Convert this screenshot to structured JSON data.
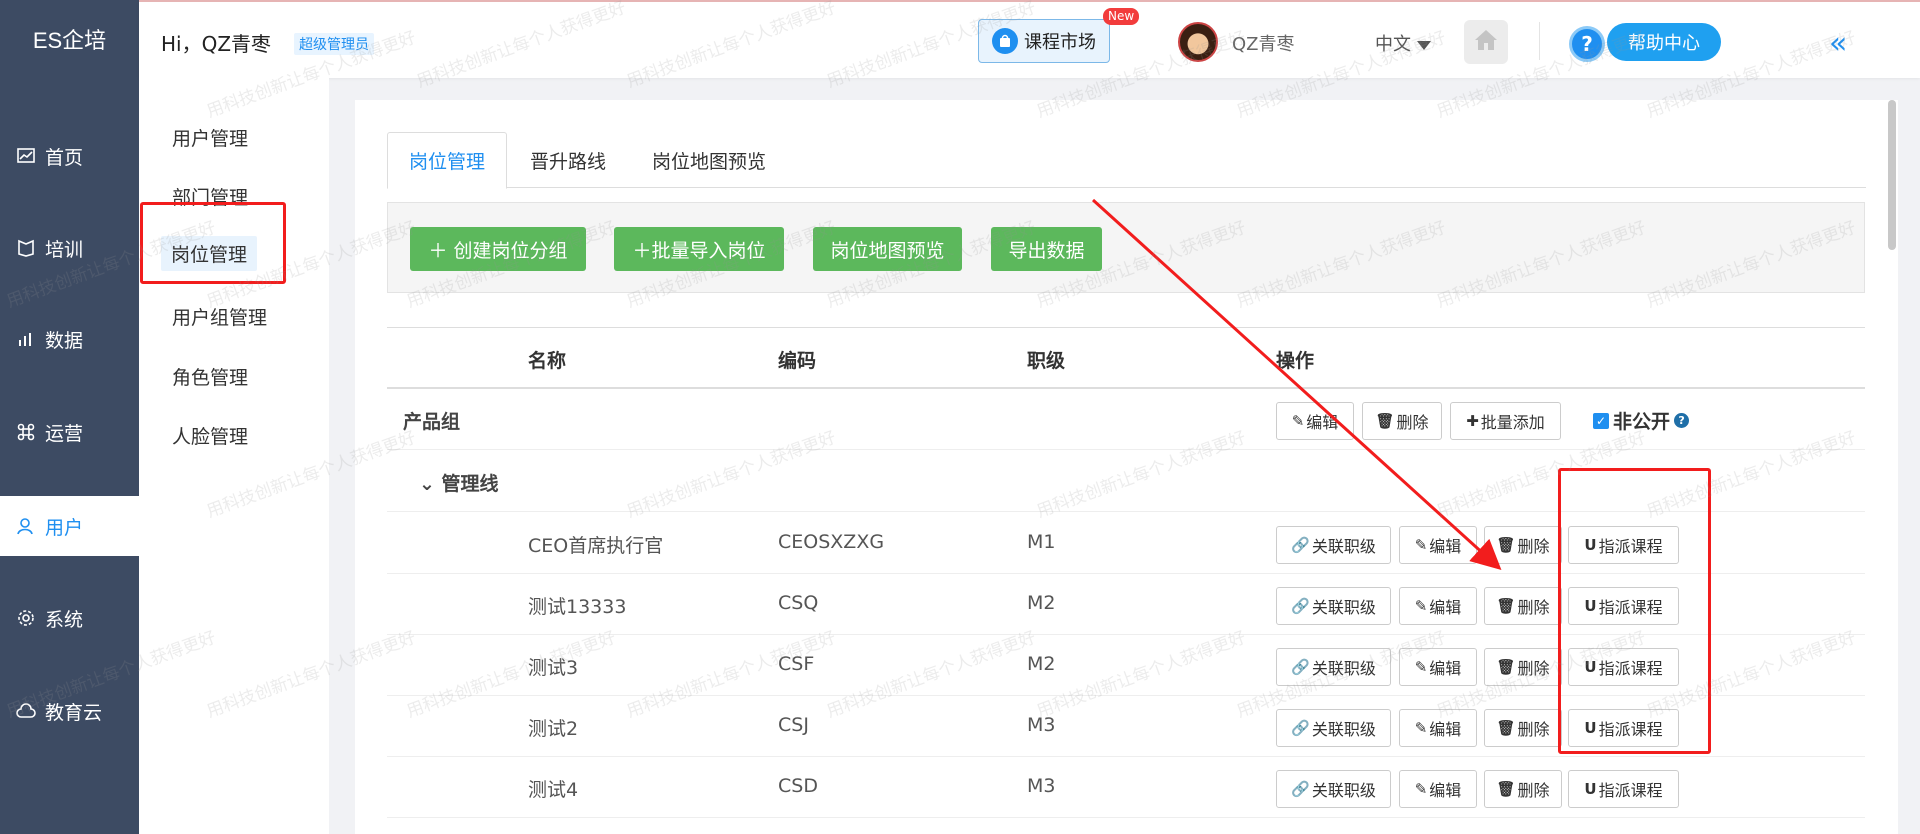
{
  "brand": "ES企培",
  "nav": [
    {
      "label": "首页",
      "icon": "chart-line-icon"
    },
    {
      "label": "培训",
      "icon": "training-icon"
    },
    {
      "label": "数据",
      "icon": "bar-chart-icon"
    },
    {
      "label": "运营",
      "icon": "command-icon"
    },
    {
      "label": "用户",
      "icon": "user-icon"
    },
    {
      "label": "系统",
      "icon": "gear-icon"
    },
    {
      "label": "教育云",
      "icon": "cloud-icon"
    }
  ],
  "header": {
    "greeting": "Hi，QZ青枣",
    "role": "超级管理员",
    "market": "课程市场",
    "new_badge": "New",
    "username": "QZ青枣",
    "language": "中文",
    "help": "帮助中心"
  },
  "submenu": [
    "用户管理",
    "部门管理",
    "岗位管理",
    "用户组管理",
    "角色管理",
    "人脸管理"
  ],
  "tabs": [
    "岗位管理",
    "晋升路线",
    "岗位地图预览"
  ],
  "toolbar": {
    "create_group": "＋ 创建岗位分组",
    "batch_import": "＋批量导入岗位",
    "map_preview": "岗位地图预览",
    "export": "导出数据"
  },
  "table": {
    "headers": {
      "name": "名称",
      "code": "编码",
      "level": "职级",
      "ops": "操作"
    },
    "group": {
      "name": "产品组",
      "edit": "编辑",
      "delete": "删除",
      "batch_add": "批量添加",
      "private": "非公开"
    },
    "subgroup": "管理线",
    "row_actions": {
      "link_level": "关联职级",
      "edit": "编辑",
      "delete": "删除",
      "assign": "指派课程"
    },
    "rows": [
      {
        "name": "CEO首席执行官",
        "code": "CEOSXZXG",
        "level": "M1"
      },
      {
        "name": "测试13333",
        "code": "CSQ",
        "level": "M2"
      },
      {
        "name": "测试3",
        "code": "CSF",
        "level": "M2"
      },
      {
        "name": "测试2",
        "code": "CSJ",
        "level": "M3"
      },
      {
        "name": "测试4",
        "code": "CSD",
        "level": "M3"
      }
    ]
  },
  "watermark_text": "用科技创新让每个人获得更好",
  "colors": {
    "sidebar": "#3d4b63",
    "accent": "#1f8ff0",
    "green": "#5cb85c",
    "annotation": "#f21d1d"
  }
}
